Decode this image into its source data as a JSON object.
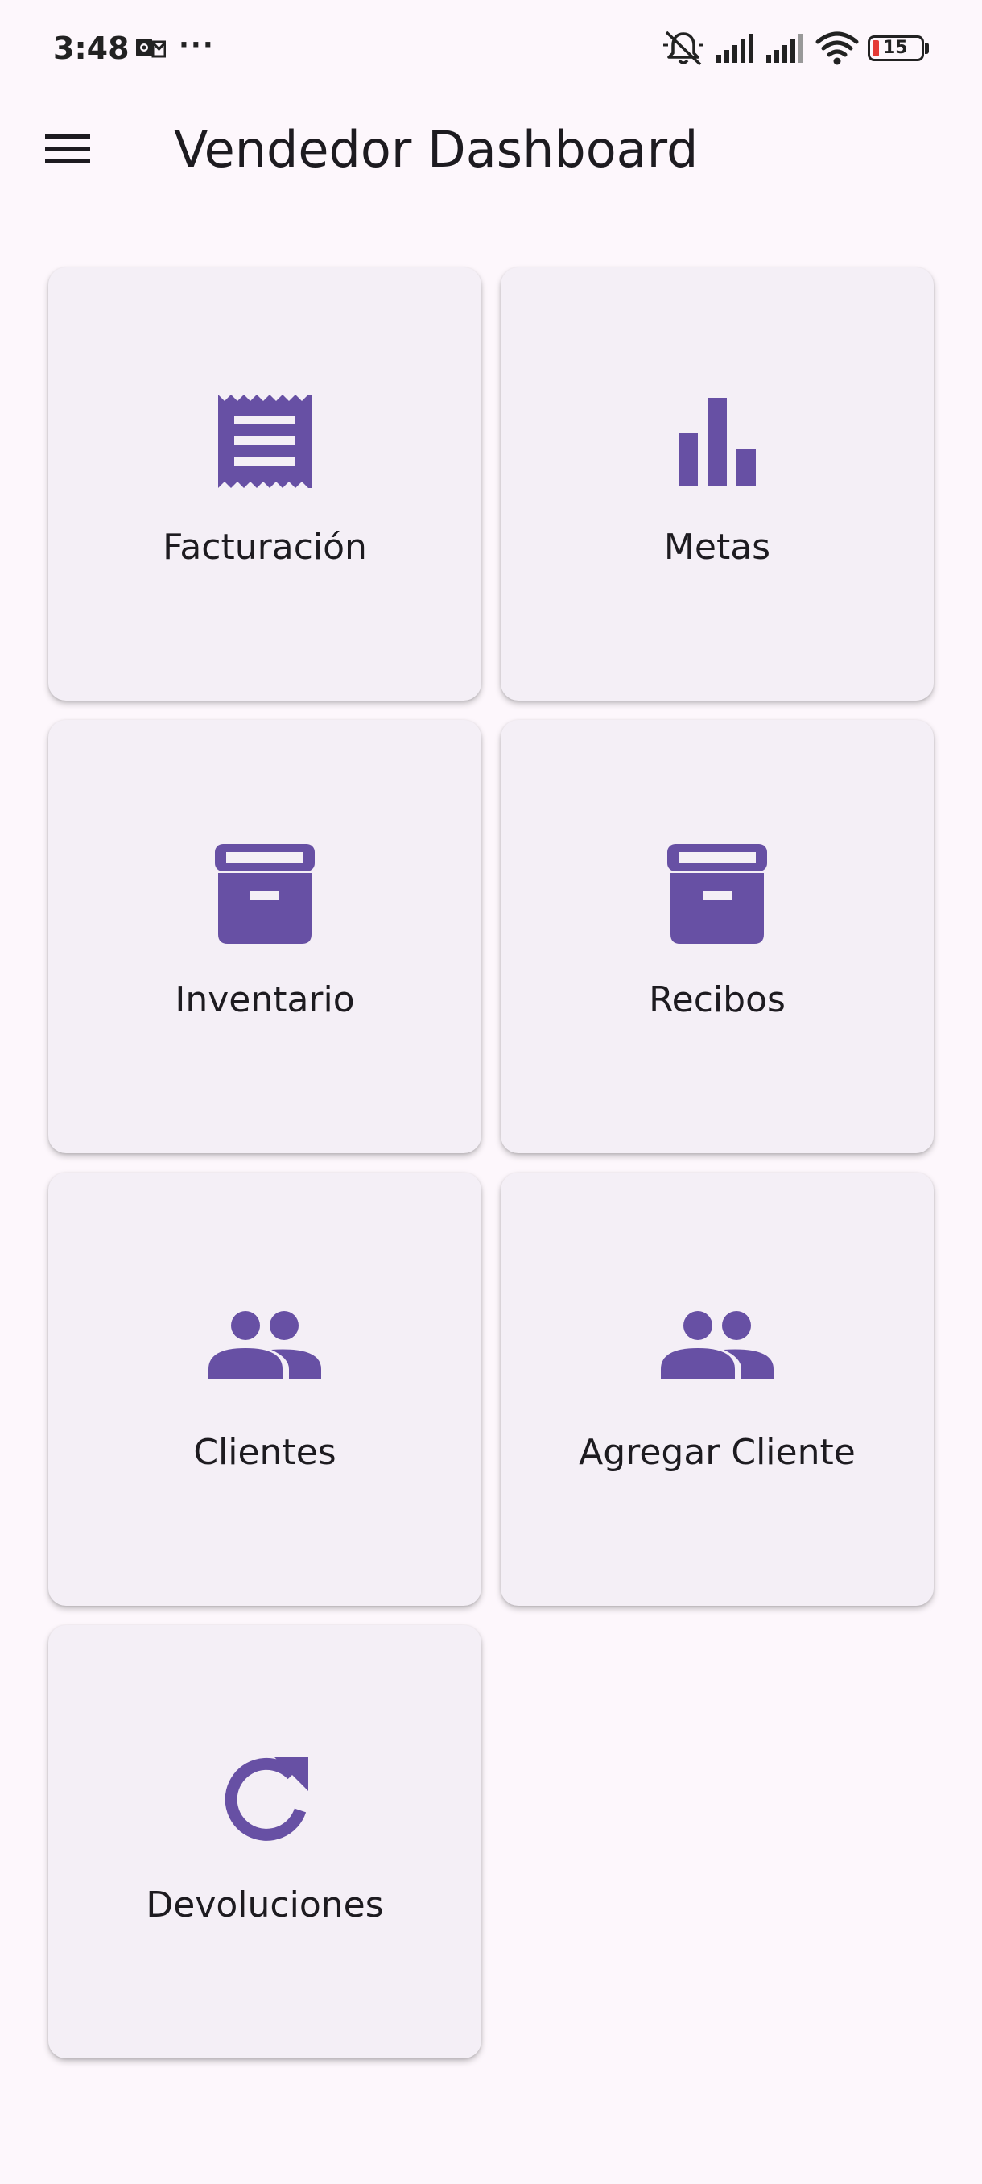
{
  "status_bar": {
    "time": "3:48",
    "more": "···",
    "battery": "15"
  },
  "app_bar": {
    "title": "Vendedor Dashboard"
  },
  "colors": {
    "accent": "#6750A4",
    "background": "#FDF7FC",
    "card": "#F4EFF6"
  },
  "cards": [
    {
      "label": "Facturación",
      "icon": "receipt-icon"
    },
    {
      "label": "Metas",
      "icon": "bar-chart-icon"
    },
    {
      "label": "Inventario",
      "icon": "archive-box-icon"
    },
    {
      "label": "Recibos",
      "icon": "archive-box-icon"
    },
    {
      "label": "Clientes",
      "icon": "people-icon"
    },
    {
      "label": "Agregar Cliente",
      "icon": "people-icon"
    },
    {
      "label": "Devoluciones",
      "icon": "refresh-icon"
    }
  ]
}
